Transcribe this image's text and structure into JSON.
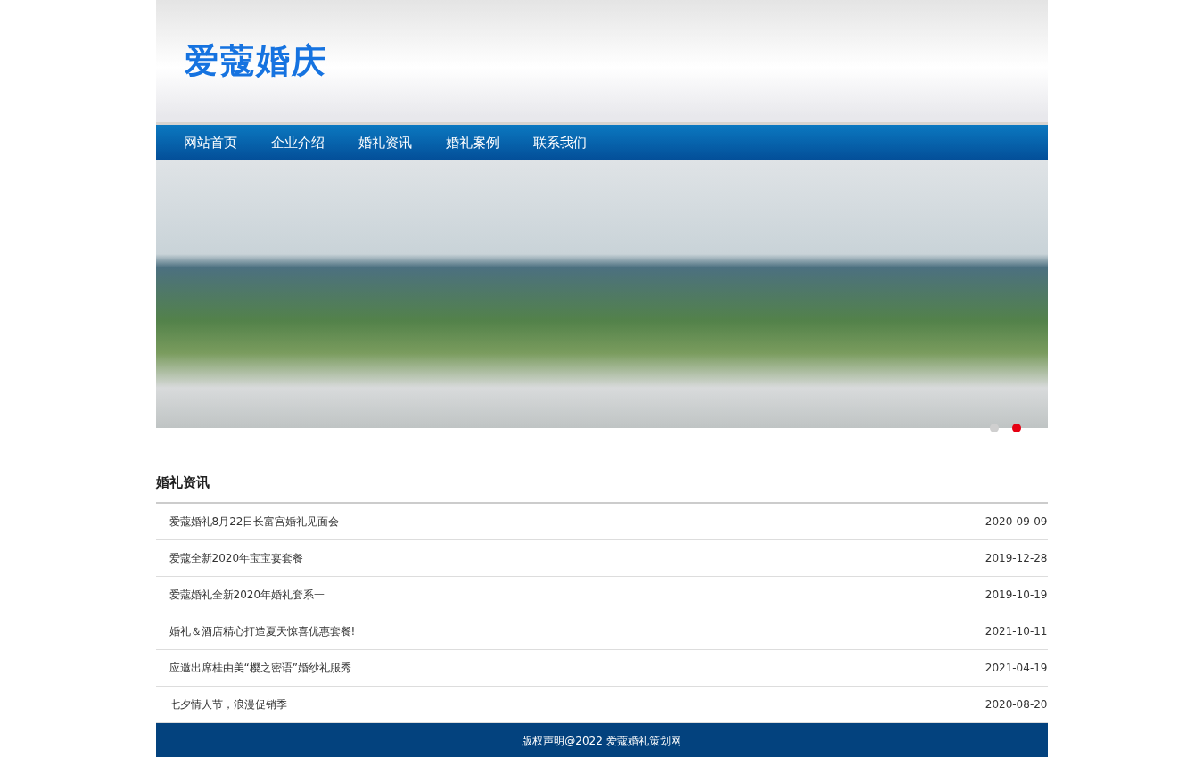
{
  "header": {
    "logo": "爱蔻婚庆"
  },
  "nav": {
    "items": [
      {
        "label": "网站首页"
      },
      {
        "label": "企业介绍"
      },
      {
        "label": "婚礼资讯"
      },
      {
        "label": "婚礼案例"
      },
      {
        "label": "联系我们"
      }
    ]
  },
  "banner": {
    "dots": [
      {
        "selected": false
      },
      {
        "selected": true
      }
    ]
  },
  "news": {
    "title": "婚礼资讯",
    "items": [
      {
        "title": "爱蔻婚礼8月22日长富宫婚礼见面会",
        "date": "2020-09-09"
      },
      {
        "title": "爱蔻全新2020年宝宝宴套餐",
        "date": "2019-12-28"
      },
      {
        "title": "爱蔻婚礼全新2020年婚礼套系一",
        "date": "2019-10-19"
      },
      {
        "title": "婚礼＆酒店精心打造夏天惊喜优惠套餐!",
        "date": "2021-10-11"
      },
      {
        "title": "应邀出席桂由美“樱之密语”婚纱礼服秀",
        "date": "2021-04-19"
      },
      {
        "title": "七夕情人节，浪漫促销季",
        "date": "2020-08-20"
      }
    ]
  },
  "footer": {
    "text": "版权声明@2022 爱蔻婚礼策划网"
  }
}
